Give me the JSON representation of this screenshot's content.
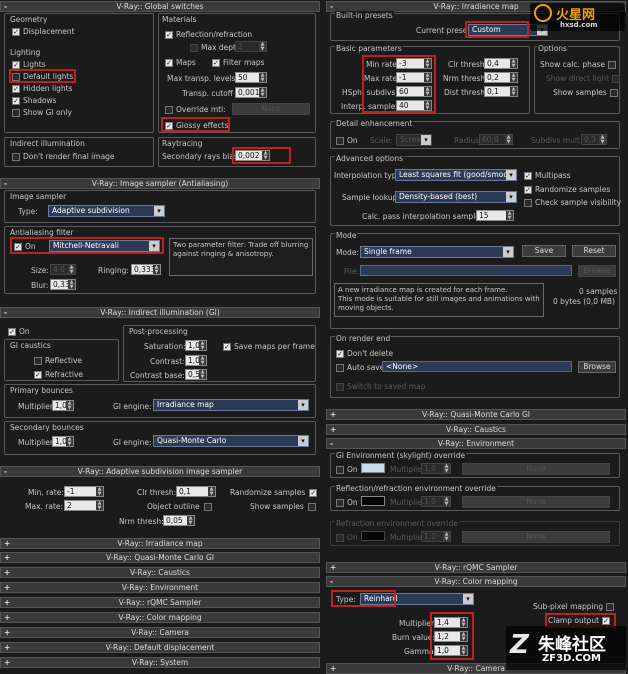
{
  "colors": {
    "highlight": "#c02020",
    "panel": "#1b1b1b",
    "rollout_bar": "#3a3a3a",
    "dropdown": "#2c3a55"
  },
  "left": {
    "global": {
      "title": "V-Ray:: Global switches",
      "geometry": "Geometry",
      "displacement": "Displacement",
      "lighting": "Lighting",
      "lights": "Lights",
      "default_lights": "Default lights",
      "hidden_lights": "Hidden lights",
      "shadows": "Shadows",
      "show_gi_only": "Show GI only",
      "indirect": "Indirect illumination",
      "dont_render_final": "Don't render final image",
      "materials": "Materials",
      "reflection_refraction": "Reflection/refraction",
      "max_depth": "Max depth",
      "max_depth_val": "2",
      "maps": "Maps",
      "filter_maps": "Filter maps",
      "max_transp_levels": "Max transp. levels",
      "max_transp_levels_val": "50",
      "transp_cutoff": "Transp. cutoff",
      "transp_cutoff_val": "0,001",
      "override_mtl": "Override mtl:",
      "none": "None",
      "glossy_effects": "Glossy effects",
      "raytracing": "Raytracing",
      "secondary_rays_bias": "Secondary rays bias",
      "secondary_rays_bias_val": "0,002"
    },
    "sampler": {
      "title": "V-Ray:: Image sampler (Antialiasing)",
      "image_sampler": "Image sampler",
      "type_label": "Type:",
      "type_val": "Adaptive subdivision",
      "aa_filter": "Antialiasing filter",
      "on": "On",
      "filter_val": "Mitchell-Netravali",
      "desc": "Two parameter filter: Trade off blurring against ringing & anisotropy.",
      "size": "Size:",
      "size_val": "4,0",
      "ringing": "Ringing:",
      "ringing_val": "0,333",
      "blur": "Blur:",
      "blur_val": "0,333"
    },
    "gi": {
      "title": "V-Ray:: Indirect illumination (GI)",
      "on": "On",
      "gi_caustics": "GI caustics",
      "reflective": "Reflective",
      "refractive": "Refractive",
      "post": "Post-processing",
      "saturation": "Saturation:",
      "saturation_val": "1,0",
      "save_maps": "Save maps per frame",
      "contrast": "Contrast:",
      "contrast_val": "1,0",
      "contrast_base": "Contrast base:",
      "contrast_base_val": "0,5",
      "primary": "Primary bounces",
      "multiplier": "Multiplier:",
      "primary_mult": "1,0",
      "gi_engine": "GI engine:",
      "primary_engine": "Irradiance map",
      "secondary": "Secondary bounces",
      "secondary_mult": "1,0",
      "secondary_engine": "Quasi-Monte Carlo"
    },
    "adaptive": {
      "title": "V-Ray:: Adaptive subdivision image sampler",
      "min_rate": "Min. rate:",
      "min_rate_val": "-1",
      "max_rate": "Max. rate:",
      "max_rate_val": "2",
      "clr_thresh": "Clr thresh:",
      "clr_thresh_val": "0,1",
      "object_outline": "Object outline",
      "nrm_thresh": "Nrm thresh:",
      "nrm_thresh_val": "0,05",
      "randomize": "Randomize samples",
      "show_samples": "Show samples"
    },
    "collapsed": [
      "V-Ray:: Irradiance map",
      "V-Ray:: Quasi-Monte Carlo GI",
      "V-Ray:: Caustics",
      "V-Ray:: Environment",
      "V-Ray:: rQMC Sampler",
      "V-Ray:: Color mapping",
      "V-Ray:: Camera",
      "V-Ray:: Default displacement",
      "V-Ray:: System"
    ]
  },
  "right": {
    "irr": {
      "title": "V-Ray:: Irradiance map",
      "builtin": "Built-in presets",
      "current_preset": "Current preset:",
      "preset_val": "Custom",
      "basic": "Basic parameters",
      "min_rate": "Min rate:",
      "min_rate_val": "-3",
      "max_rate": "Max rate:",
      "max_rate_val": "-1",
      "hsph": "HSph. subdivs:",
      "hsph_val": "60",
      "interp": "Interp. samples:",
      "interp_val": "40",
      "clr_thresh": "Clr thresh:",
      "clr_thresh_val": "0,4",
      "nrm_thresh": "Nrm thresh:",
      "nrm_thresh_val": "0,2",
      "dist_thresh": "Dist thresh:",
      "dist_thresh_val": "0,1",
      "options": "Options",
      "show_calc": "Show calc. phase",
      "show_direct": "Show direct light",
      "show_samples": "Show samples",
      "detail": "Detail enhancement",
      "on": "On",
      "scale": "Scale:",
      "scale_val": "Screen",
      "radius": "Radius:",
      "radius_val": "60,0",
      "subdiv_mult": "Subdivs mult.:",
      "subdiv_mult_val": "0,3",
      "advanced": "Advanced options",
      "interp_type": "Interpolation type:",
      "interp_type_val": "Least squares fit (good/smooth",
      "multipass": "Multipass",
      "sample_lookup": "Sample lookup:",
      "sample_lookup_val": "Density-based (best)",
      "randomize": "Randomize samples",
      "check_vis": "Check sample visibility",
      "calc_pass": "Calc. pass interpolation samples:",
      "calc_pass_val": "15",
      "mode": "Mode",
      "mode_label": "Mode:",
      "mode_val": "Single frame",
      "save": "Save",
      "reset": "Reset",
      "file": "File:",
      "browse": "Browse",
      "mode_desc": "A new irradiance map is created for each frame.\nThis mode is suitable for still images and animations with moving objects.",
      "samples": "0 samples",
      "bytes": "0 bytes (0,0 MB)",
      "on_render_end": "On render end",
      "dont_delete": "Don't delete",
      "auto_save": "Auto save:",
      "auto_save_val": "<None>",
      "switch_saved": "Switch to saved map"
    },
    "qmc": "V-Ray:: Quasi-Monte Carlo GI",
    "caustics": "V-Ray:: Caustics",
    "env": {
      "title": "V-Ray:: Environment",
      "gi_env": "GI Environment (skylight) override",
      "refl_env": "Reflection/refraction environment override",
      "refr_env": "Refraction environment override",
      "on": "On",
      "multiplier": "Multiplier:",
      "mult_val": "1,0",
      "none": "None"
    },
    "rqmc": "V-Ray:: rQMC Sampler",
    "cm": {
      "title": "V-Ray:: Color mapping",
      "type_label": "Type:",
      "type_val": "Reinhard",
      "subpixel": "Sub-pixel mapping",
      "clamp": "Clamp output",
      "multiplier": "Multiplier:",
      "mult_val": "1,4",
      "burn": "Burn value:",
      "burn_val": "1,2",
      "gamma": "Gamma:",
      "gamma_val": "1,0"
    },
    "camera": "V-Ray:: Camera"
  },
  "watermark": {
    "top_logo": "火星网",
    "top_url": "hxsd.com",
    "bottom_logo": "朱峰社区",
    "bottom_url": "ZF3D.COM"
  }
}
